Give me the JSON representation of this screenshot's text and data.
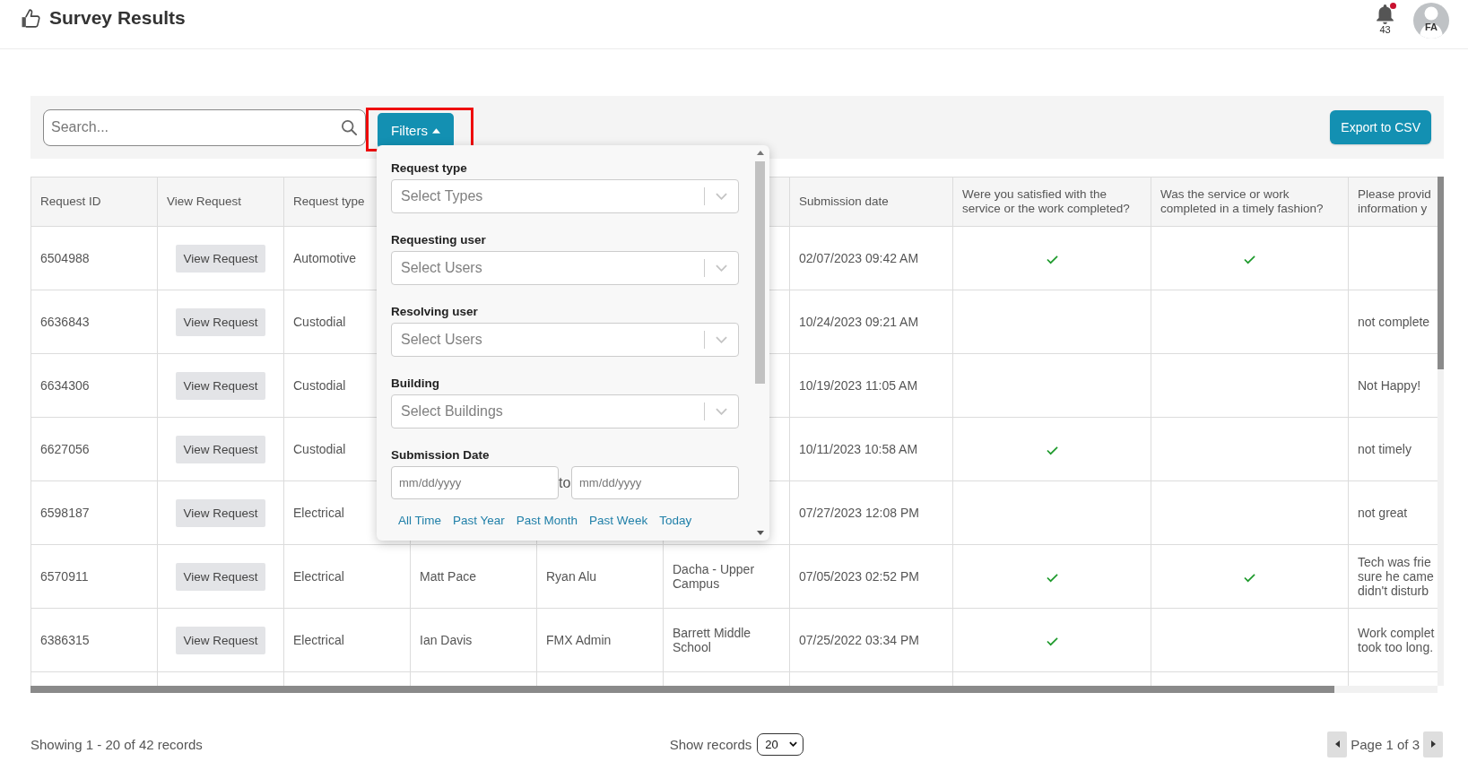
{
  "header": {
    "title": "Survey Results",
    "notifications": {
      "count": "43",
      "unread": true
    },
    "avatar": {
      "initials": "FA"
    }
  },
  "toolbar": {
    "search": {
      "placeholder": "Search..."
    },
    "filters_button": {
      "label": "Filters",
      "expanded": true,
      "highlighted": true
    },
    "export_button": {
      "label": "Export to CSV"
    }
  },
  "filters_panel": {
    "fields": [
      {
        "kind": "select",
        "label": "Request type",
        "placeholder": "Select Types"
      },
      {
        "kind": "select",
        "label": "Requesting user",
        "placeholder": "Select Users"
      },
      {
        "kind": "select",
        "label": "Resolving user",
        "placeholder": "Select Users"
      },
      {
        "kind": "select",
        "label": "Building",
        "placeholder": "Select Buildings"
      },
      {
        "kind": "date_range",
        "label": "Submission Date",
        "from": {
          "placeholder": "mm/dd/yyyy"
        },
        "separator": "to",
        "to": {
          "placeholder": "mm/dd/yyyy"
        }
      }
    ],
    "quick_ranges": [
      "All Time",
      "Past Year",
      "Past Month",
      "Past Week",
      "Today"
    ]
  },
  "table": {
    "headers": {
      "request_id": "Request ID",
      "view_request": "View Request",
      "request_type": "Request type",
      "submission_date": "Submission date",
      "satisfied": "Were you satisfied with the service or the work completed?",
      "timely": "Was the service or work completed in a timely fashion?",
      "column_10": "Please provid information y"
    },
    "rows": [
      {
        "request_id": "6504988",
        "view_request": "View Request",
        "request_type": "Automotive",
        "submission_date": "02/07/2023 09:42 AM",
        "satisfied": true,
        "timely": true
      },
      {
        "request_id": "6636843",
        "view_request": "View Request",
        "request_type": "Custodial",
        "submission_date": "10/24/2023 09:21 AM",
        "satisfied": false,
        "timely": false,
        "column_10": [
          "not complete"
        ]
      },
      {
        "request_id": "6634306",
        "view_request": "View Request",
        "request_type": "Custodial",
        "submission_date": "10/19/2023 11:05 AM",
        "satisfied": false,
        "timely": false,
        "column_10": [
          "Not Happy!"
        ]
      },
      {
        "request_id": "6627056",
        "view_request": "View Request",
        "request_type": "Custodial",
        "submission_date": "10/11/2023 10:58 AM",
        "satisfied": true,
        "timely": false,
        "column_10": [
          "not timely"
        ]
      },
      {
        "request_id": "6598187",
        "view_request": "View Request",
        "request_type": "Electrical",
        "submission_date": "07/27/2023 12:08 PM",
        "satisfied": false,
        "timely": false,
        "column_10": [
          "not great"
        ]
      },
      {
        "request_id": "6570911",
        "view_request": "View Request",
        "request_type": "Electrical",
        "column_4": "Matt Pace",
        "column_5": "Ryan Alu",
        "column_6": "Dacha - Upper Campus",
        "submission_date": "07/05/2023 02:52 PM",
        "satisfied": true,
        "timely": true,
        "column_10": [
          "Tech was frie",
          "sure he came",
          "didn't disturb"
        ]
      },
      {
        "request_id": "6386315",
        "view_request": "View Request",
        "request_type": "Electrical",
        "column_4": "Ian Davis",
        "column_5": "FMX Admin",
        "column_6": "Barrett Middle School",
        "submission_date": "07/25/2022 03:34 PM",
        "satisfied": true,
        "timely": false,
        "column_10": [
          "Work complet",
          "took too long."
        ]
      }
    ]
  },
  "footer": {
    "summary": "Showing 1 - 20 of 42 records",
    "page_size": {
      "label": "Show records",
      "value": "20"
    },
    "pagination": {
      "label": "Page 1 of 3"
    }
  }
}
